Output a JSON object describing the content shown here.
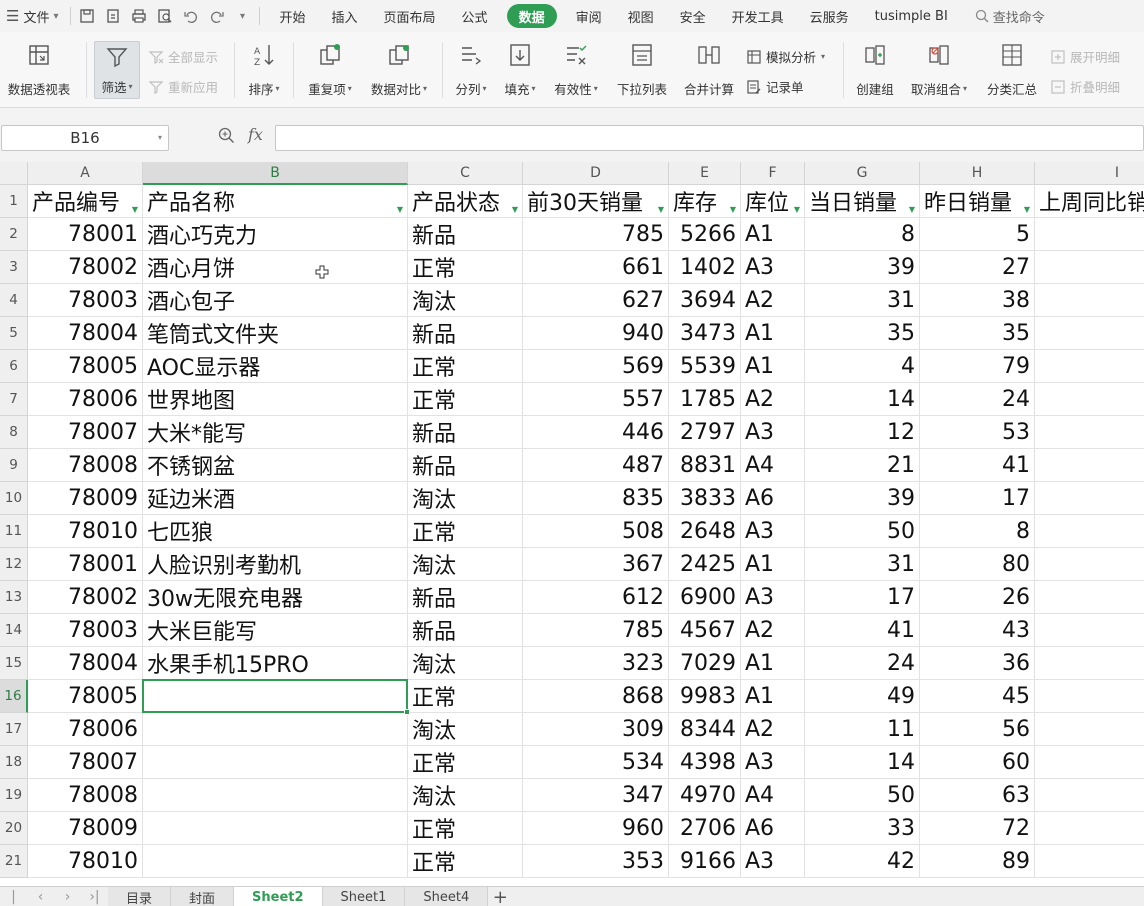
{
  "menubar": {
    "file_label": "文件",
    "tabs": [
      "开始",
      "插入",
      "页面布局",
      "公式",
      "数据",
      "审阅",
      "视图",
      "安全",
      "开发工具",
      "云服务",
      "tusimple BI"
    ],
    "active_tab": "数据",
    "search_label": "查找命令"
  },
  "ribbon": {
    "pivot": "数据透视表",
    "filter": "筛选",
    "show_all": "全部显示",
    "reapply": "重新应用",
    "sort": "排序",
    "duplicates": "重复项",
    "compare": "数据对比",
    "split": "分列",
    "fill": "填充",
    "validity": "有效性",
    "dropdown_list": "下拉列表",
    "consolidate": "合并计算",
    "simulate": "模拟分析",
    "record": "记录单",
    "create_group": "创建组",
    "ungroup": "取消组合",
    "subtotal": "分类汇总",
    "expand_detail": "展开明细",
    "collapse_detail": "折叠明细"
  },
  "formula_bar": {
    "name_box": "B16",
    "fx": "fx",
    "formula": ""
  },
  "grid": {
    "columns": [
      "A",
      "B",
      "C",
      "D",
      "E",
      "F",
      "G",
      "H",
      "I"
    ],
    "selected_column": "B",
    "selected_row": 16,
    "header_row": [
      "产品编号",
      "产品名称",
      "产品状态",
      "前30天销量",
      "库存",
      "库位",
      "当日销量",
      "昨日销量",
      "上周同比销"
    ],
    "rows": [
      [
        "78001",
        "酒心巧克力",
        "新品",
        "785",
        "5266",
        "A1",
        "8",
        "5"
      ],
      [
        "78002",
        "酒心月饼",
        "正常",
        "661",
        "1402",
        "A3",
        "39",
        "27"
      ],
      [
        "78003",
        "酒心包子",
        "淘汰",
        "627",
        "3694",
        "A2",
        "31",
        "38"
      ],
      [
        "78004",
        "笔筒式文件夹",
        "新品",
        "940",
        "3473",
        "A1",
        "35",
        "35"
      ],
      [
        "78005",
        "AOC显示器",
        "正常",
        "569",
        "5539",
        "A1",
        "4",
        "79"
      ],
      [
        "78006",
        "世界地图",
        "正常",
        "557",
        "1785",
        "A2",
        "14",
        "24"
      ],
      [
        "78007",
        "大米*能写",
        "新品",
        "446",
        "2797",
        "A3",
        "12",
        "53"
      ],
      [
        "78008",
        "不锈钢盆",
        "新品",
        "487",
        "8831",
        "A4",
        "21",
        "41"
      ],
      [
        "78009",
        "延边米酒",
        "淘汰",
        "835",
        "3833",
        "A6",
        "39",
        "17"
      ],
      [
        "78010",
        "七匹狼",
        "正常",
        "508",
        "2648",
        "A3",
        "50",
        "8"
      ],
      [
        "78001",
        "人脸识别考勤机",
        "淘汰",
        "367",
        "2425",
        "A1",
        "31",
        "80"
      ],
      [
        "78002",
        "30w无限充电器",
        "新品",
        "612",
        "6900",
        "A3",
        "17",
        "26"
      ],
      [
        "78003",
        "大米巨能写",
        "新品",
        "785",
        "4567",
        "A2",
        "41",
        "43"
      ],
      [
        "78004",
        "水果手机15PRO",
        "淘汰",
        "323",
        "7029",
        "A1",
        "24",
        "36"
      ],
      [
        "78005",
        "",
        "正常",
        "868",
        "9983",
        "A1",
        "49",
        "45"
      ],
      [
        "78006",
        "",
        "淘汰",
        "309",
        "8344",
        "A2",
        "11",
        "56"
      ],
      [
        "78007",
        "",
        "正常",
        "534",
        "4398",
        "A3",
        "14",
        "60"
      ],
      [
        "78008",
        "",
        "淘汰",
        "347",
        "4970",
        "A4",
        "50",
        "63"
      ],
      [
        "78009",
        "",
        "正常",
        "960",
        "2706",
        "A6",
        "33",
        "72"
      ],
      [
        "78010",
        "",
        "正常",
        "353",
        "9166",
        "A3",
        "42",
        "89"
      ]
    ]
  },
  "sheets": {
    "tabs": [
      "目录",
      "封面",
      "Sheet2",
      "Sheet1",
      "Sheet4"
    ],
    "active": "Sheet2",
    "add_label": "+"
  },
  "colors": {
    "accent": "#2f9e54"
  }
}
